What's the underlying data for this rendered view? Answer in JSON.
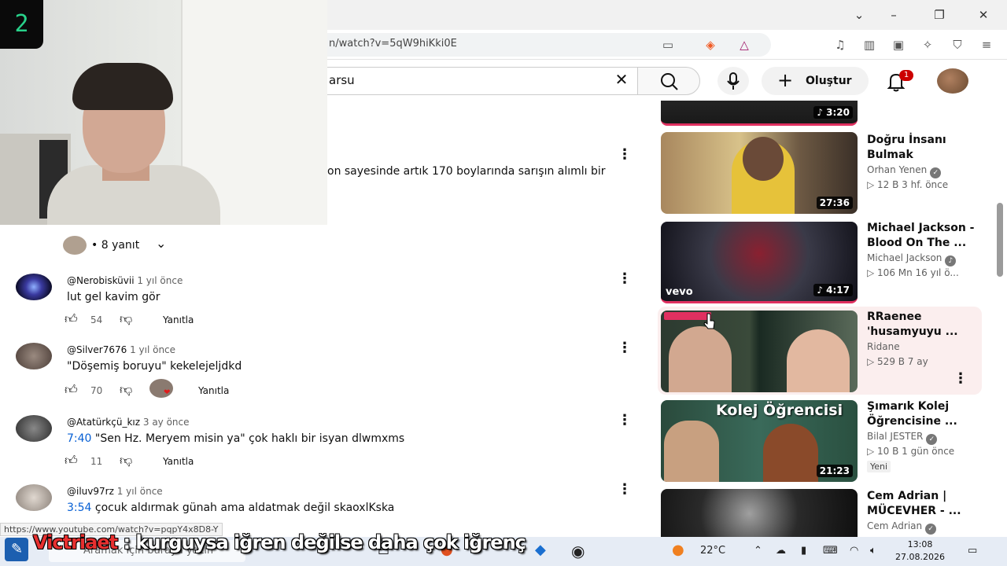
{
  "browser": {
    "url": "n/watch?v=5qW9hiKki0E"
  },
  "youtube": {
    "search_value": "arsu",
    "create_label": "Oluştur",
    "notification_count": "1"
  },
  "webcam": {
    "overlay_number": "2"
  },
  "comments": {
    "partial_text": "on sayesinde artık 170 boylarında sarışın alımlı bir",
    "replies_label": "• 8 yanıt",
    "reply_label": "Yanıtla",
    "items": [
      {
        "handle": "@Nerobisküvii",
        "time": "1 yıl önce",
        "text": "lut gel kavim gör",
        "timestamp": "",
        "likes": "54"
      },
      {
        "handle": "@Silver7676",
        "time": "1 yıl önce",
        "text": "\"Döşemiş boruyu\" kekelejeljdkd",
        "timestamp": "",
        "likes": "70"
      },
      {
        "handle": "@Atatürkçü_kız",
        "time": "3 ay önce",
        "text": " \"Sen Hz. Meryem misin ya\" çok haklı bir isyan dlwmxms",
        "timestamp": "7:40",
        "likes": "11"
      },
      {
        "handle": "@iluv97rz",
        "time": "1 yıl önce",
        "text": " çocuk aldırmak günah ama aldatmak değil skaoxlKska",
        "timestamp": "3:54",
        "likes": ""
      }
    ]
  },
  "sidebar": {
    "videos": [
      {
        "title": "",
        "channel": "",
        "meta": "",
        "duration": "♪ 3:20"
      },
      {
        "title": "Doğru İnsanı Bulmak",
        "channel": "Orhan Yenen",
        "meta": "▷ 12 B  3 hf. önce",
        "duration": "27:36"
      },
      {
        "title": "Michael Jackson - Blood On The ...",
        "channel": "Michael Jackson",
        "meta": "▷ 106 Mn  16 yıl ö...",
        "duration": "♪ 4:17",
        "logo": "vevo"
      },
      {
        "title": "RRaenee 'husamyuyu ...",
        "channel": "Ridane",
        "meta": "▷ 529 B  7 ay",
        "duration": ""
      },
      {
        "title": "Şımarık Kolej Öğrencisine ...",
        "channel": "Bilal JESTER",
        "meta": "▷ 10 B  1 gün önce",
        "duration": "21:23",
        "badge": "Yeni",
        "thumb_text": "Kolej Öğrencisi"
      },
      {
        "title": "Cem Adrian | MÜCEVHER - ...",
        "channel": "Cem Adrian",
        "meta": "",
        "duration": ""
      }
    ]
  },
  "status_url": "https://www.youtube.com/watch?v=pqpY4x8D8-Y",
  "taskbar": {
    "search_placeholder": "Aramak için buraya yazın",
    "weather_temp": "22°C",
    "time": "13:08",
    "date": "27.08.2026"
  },
  "chat": {
    "username": "Victriaet",
    "message": ": kurguysa iğren değilse daha çok iğrenç"
  },
  "colors": {
    "accent_blue": "#065fd4",
    "badge_red": "#cc0000",
    "highlight_bg": "#fbeeee",
    "chat_name": "#e83030"
  }
}
